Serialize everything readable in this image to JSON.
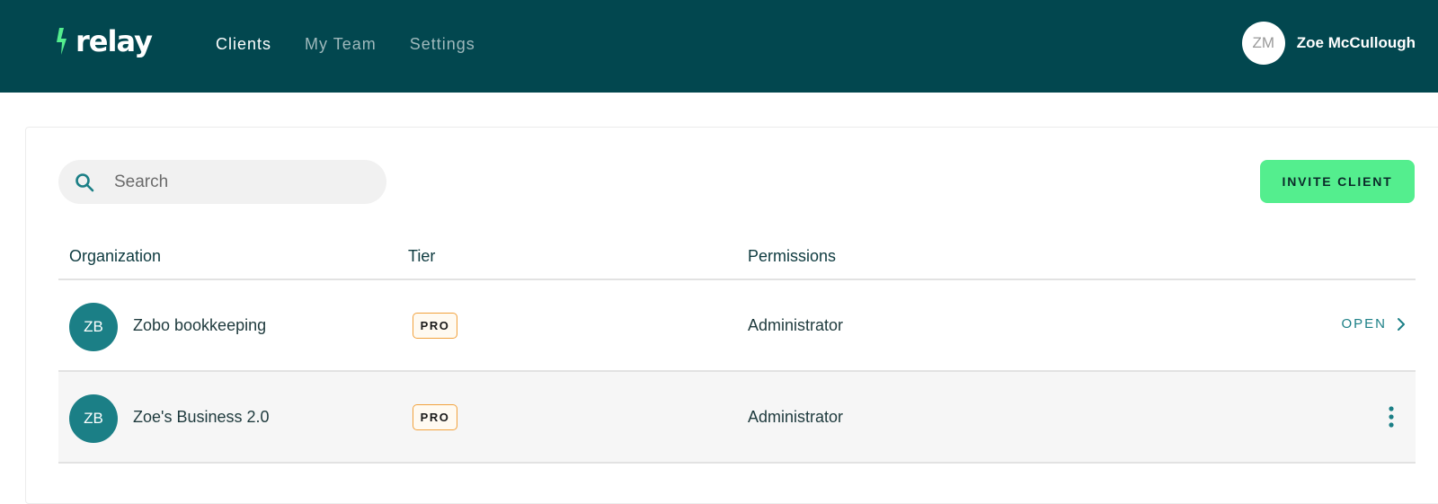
{
  "header": {
    "logo_text": "relay",
    "nav": [
      {
        "label": "Clients",
        "active": true
      },
      {
        "label": "My Team",
        "active": false
      },
      {
        "label": "Settings",
        "active": false
      }
    ],
    "user": {
      "initials": "ZM",
      "name": "Zoe McCullough"
    }
  },
  "toolbar": {
    "search_placeholder": "Search",
    "invite_label": "INVITE CLIENT"
  },
  "table": {
    "columns": [
      "Organization",
      "Tier",
      "Permissions"
    ],
    "rows": [
      {
        "initials": "ZB",
        "organization": "Zobo bookkeeping",
        "tier": "PRO",
        "permissions": "Administrator",
        "action": "OPEN"
      },
      {
        "initials": "ZB",
        "organization": "Zoe's Business 2.0",
        "tier": "PRO",
        "permissions": "Administrator"
      }
    ]
  },
  "icons": {
    "logo": "lightning-bolt-icon",
    "search": "search-icon",
    "open": "chevron-right-icon",
    "menu": "more-vertical-icon"
  },
  "colors": {
    "header_bg": "#02474f",
    "accent_green": "#54ee8e",
    "teal": "#1b7f86",
    "pro_border": "#f2a23d"
  }
}
